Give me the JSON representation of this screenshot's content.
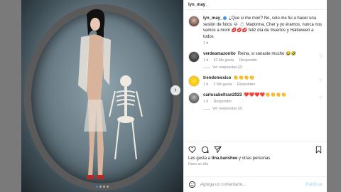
{
  "header": {
    "username": "lyn_may_"
  },
  "caption": {
    "username": "lyn_may_",
    "text": "¿Que si me morí? No, solo me fui a hacer una sesión de fotos 💀 💍 Madonna, Cher y yo éramos, nunca nos vamos a morir 💋💋💋 feliz día de muertos y Halloween a todos",
    "time": "1 d"
  },
  "comments": [
    {
      "username": "verdeamazonito",
      "text": "Reina, si sonaste mucho 😂🤣",
      "time": "1 d",
      "likes": "42 Me gusta",
      "reply": "Responder",
      "view_replies": "Ver respuestas (2)"
    },
    {
      "username": "trendomexico",
      "text": "👏👏👏👏",
      "time": "1 d",
      "likes": "2 Me gusta",
      "reply": "Responder"
    },
    {
      "username": "carlosabeltran2023",
      "text": "❤️❤️❤️❤️👏👏👏👏",
      "time": "1 d",
      "reply": "Responder",
      "view_replies": "Ver respuestas (2)"
    }
  ],
  "likes_line": {
    "prefix": "Les gusta a ",
    "user": "tina.banshee",
    "suffix": " y otras personas"
  },
  "post_time": "Hace un día",
  "add_comment": {
    "placeholder": "Agrega un comentario...",
    "publish": "Publicar"
  },
  "carousel": {
    "next_glyph": "›",
    "total": 4,
    "active_index": 0
  }
}
